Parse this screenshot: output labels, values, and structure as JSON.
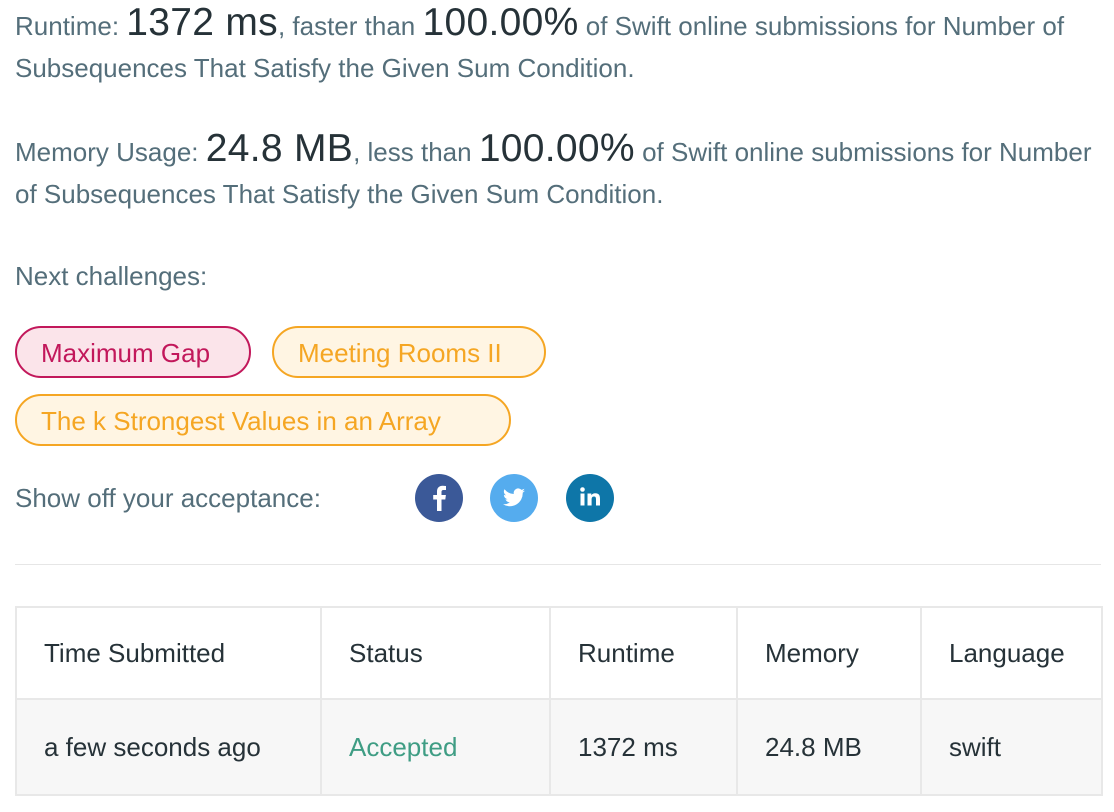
{
  "runtime": {
    "label": "Runtime: ",
    "value": "1372 ms",
    "mid": ", faster than ",
    "percent": "100.00%",
    "suffix": " of Swift online submissions for Number of Subsequences That Satisfy the Given Sum Condition."
  },
  "memory": {
    "label": "Memory Usage: ",
    "value": "24.8 MB",
    "mid": ", less than ",
    "percent": "100.00%",
    "suffix": " of Swift online submissions for Number of Subsequences That Satisfy the Given Sum Condition."
  },
  "next_challenges": {
    "label": "Next challenges:",
    "items": [
      {
        "label": "Maximum Gap",
        "difficulty": "hard"
      },
      {
        "label": "Meeting Rooms II",
        "difficulty": "medium"
      },
      {
        "label": "The k Strongest Values in an Array",
        "difficulty": "medium"
      }
    ]
  },
  "share": {
    "label": "Show off your acceptance:",
    "icons": [
      "facebook-icon",
      "twitter-icon",
      "linkedin-icon"
    ]
  },
  "colors": {
    "hard": "#c2185b",
    "medium": "#f5a623",
    "accepted": "#3f9d84",
    "facebook": "#3b5998",
    "twitter": "#55acee",
    "linkedin": "#0e76a8"
  },
  "table": {
    "headers": [
      "Time Submitted",
      "Status",
      "Runtime",
      "Memory",
      "Language"
    ],
    "rows": [
      [
        "a few seconds ago",
        "Accepted",
        "1372 ms",
        "24.8 MB",
        "swift"
      ]
    ]
  }
}
